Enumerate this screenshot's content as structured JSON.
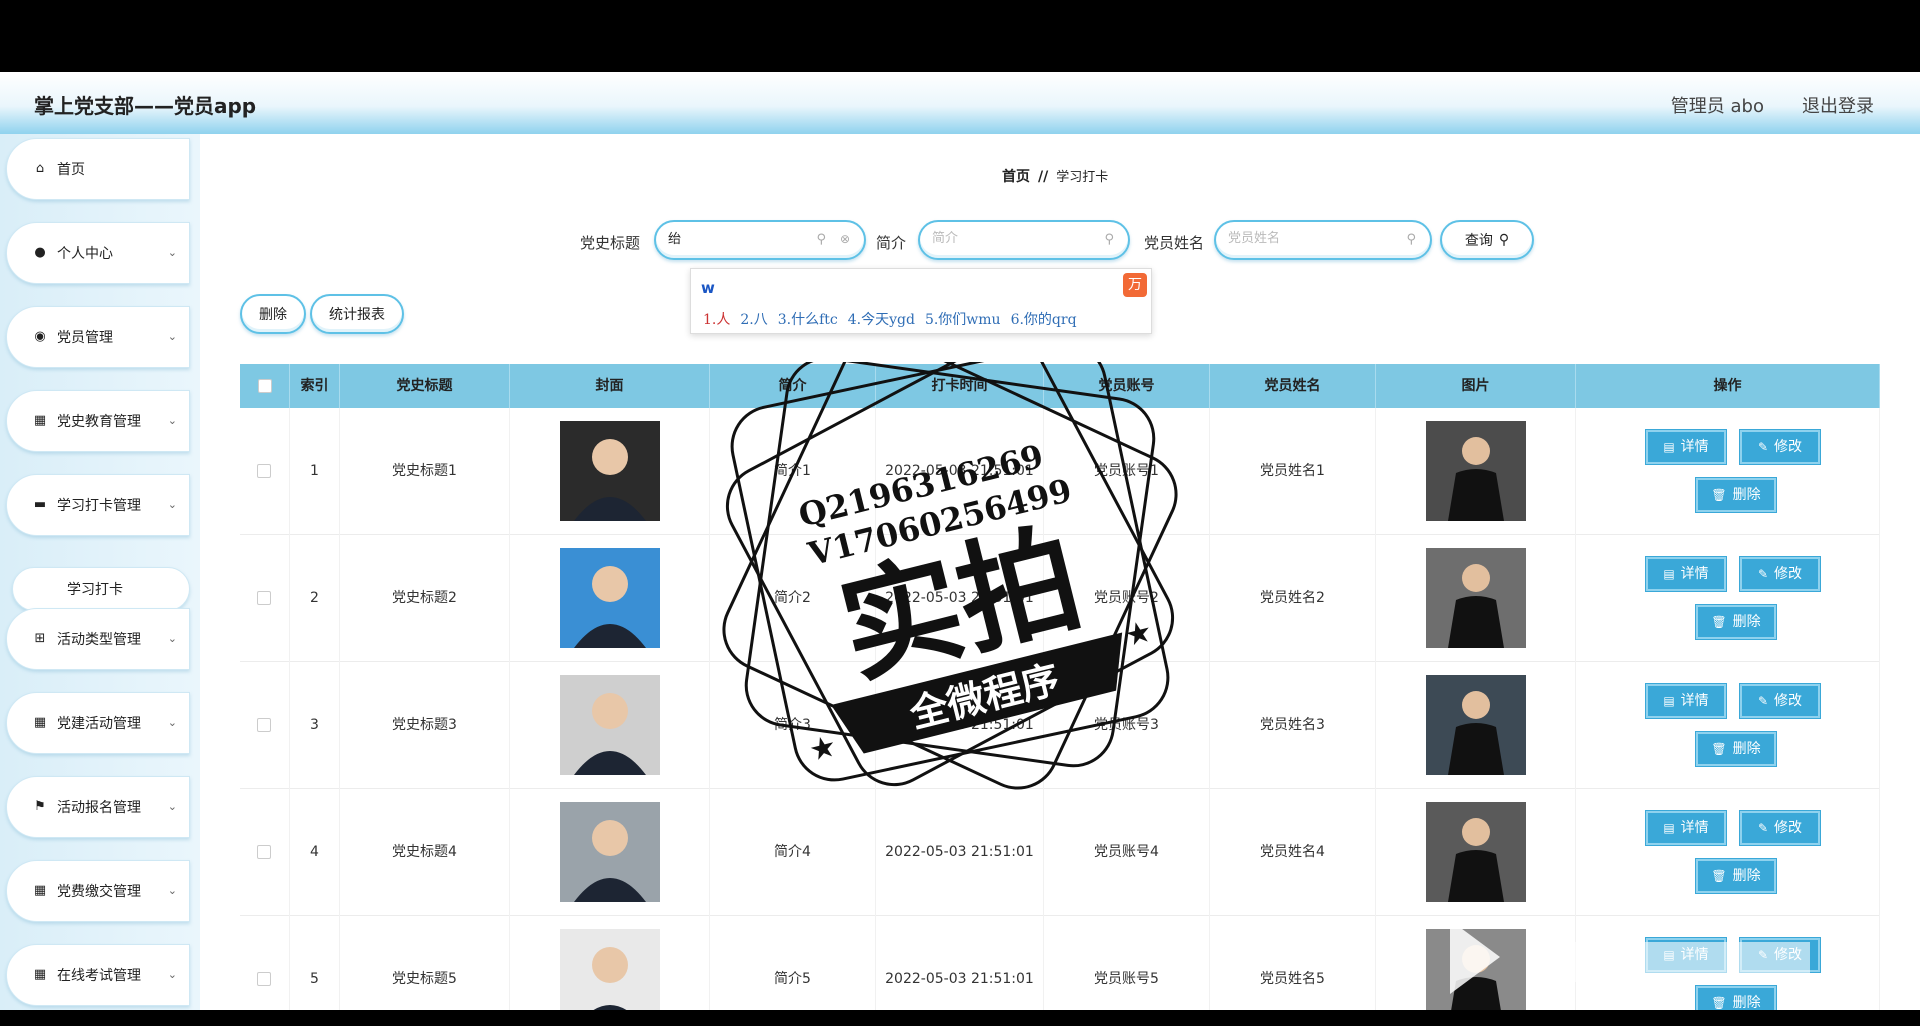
{
  "header": {
    "title": "掌上党支部——党员app",
    "admin": "管理员 abo",
    "logout": "退出登录"
  },
  "sidebar": {
    "items": [
      {
        "label": "首页",
        "icon": "home-icon",
        "expandable": false
      },
      {
        "label": "个人中心",
        "icon": "user-icon",
        "expandable": true
      },
      {
        "label": "党员管理",
        "icon": "bulb-icon",
        "expandable": true
      },
      {
        "label": "党史教育管理",
        "icon": "grid-icon",
        "expandable": true
      },
      {
        "label": "学习打卡管理",
        "icon": "briefcase-icon",
        "expandable": true
      },
      {
        "label": "学习打卡",
        "icon": "",
        "expandable": false,
        "sub": true
      },
      {
        "label": "活动类型管理",
        "icon": "grid9-icon",
        "expandable": true
      },
      {
        "label": "党建活动管理",
        "icon": "grid-icon",
        "expandable": true
      },
      {
        "label": "活动报名管理",
        "icon": "flag-icon",
        "expandable": true
      },
      {
        "label": "党费缴交管理",
        "icon": "grid-icon",
        "expandable": true
      },
      {
        "label": "在线考试管理",
        "icon": "grid-icon",
        "expandable": true
      }
    ]
  },
  "breadcrumb": {
    "home": "首页",
    "sep": "//",
    "current": "学习打卡"
  },
  "search": {
    "title_label": "党史标题",
    "title_value": "绐",
    "intro_label": "简介",
    "intro_placeholder": "简介",
    "name_label": "党员姓名",
    "name_placeholder": "党员姓名",
    "query_label": "查询"
  },
  "ime": {
    "code": "w",
    "candidates": [
      "1.人",
      "2.八",
      "3.什么ftc",
      "4.今天ygd",
      "5.你们wmu",
      "6.你的qrq"
    ]
  },
  "actions": {
    "delete": "删除",
    "report": "统计报表"
  },
  "table": {
    "columns": [
      "索引",
      "党史标题",
      "封面",
      "简介",
      "打卡时间",
      "党员账号",
      "党员姓名",
      "图片",
      "操作"
    ],
    "rows": [
      {
        "index": "1",
        "title": "党史标题1",
        "intro": "简介1",
        "time": "2022-05-03 21:51:01",
        "account": "党员账号1",
        "name": "党员姓名1"
      },
      {
        "index": "2",
        "title": "党史标题2",
        "intro": "简介2",
        "time": "2022-05-03 21:51:01",
        "account": "党员账号2",
        "name": "党员姓名2"
      },
      {
        "index": "3",
        "title": "党史标题3",
        "intro": "简介3",
        "time": "2022-05-03 21:51:01",
        "account": "党员账号3",
        "name": "党员姓名3"
      },
      {
        "index": "4",
        "title": "党史标题4",
        "intro": "简介4",
        "time": "2022-05-03 21:51:01",
        "account": "党员账号4",
        "name": "党员姓名4"
      },
      {
        "index": "5",
        "title": "党史标题5",
        "intro": "简介5",
        "time": "2022-05-03 21:51:01",
        "account": "党员账号5",
        "name": "党员姓名5"
      }
    ],
    "op_detail": "详情",
    "op_edit": "修改",
    "op_delete": "删除"
  },
  "watermark": {
    "qq": "Q2196316269",
    "wx": "V17060256499",
    "main": "实拍",
    "sub": "全微程序"
  },
  "colors": {
    "accent": "#3aa8d8",
    "header_bg": "#8fd2ee",
    "table_head": "#7ec8e3"
  }
}
